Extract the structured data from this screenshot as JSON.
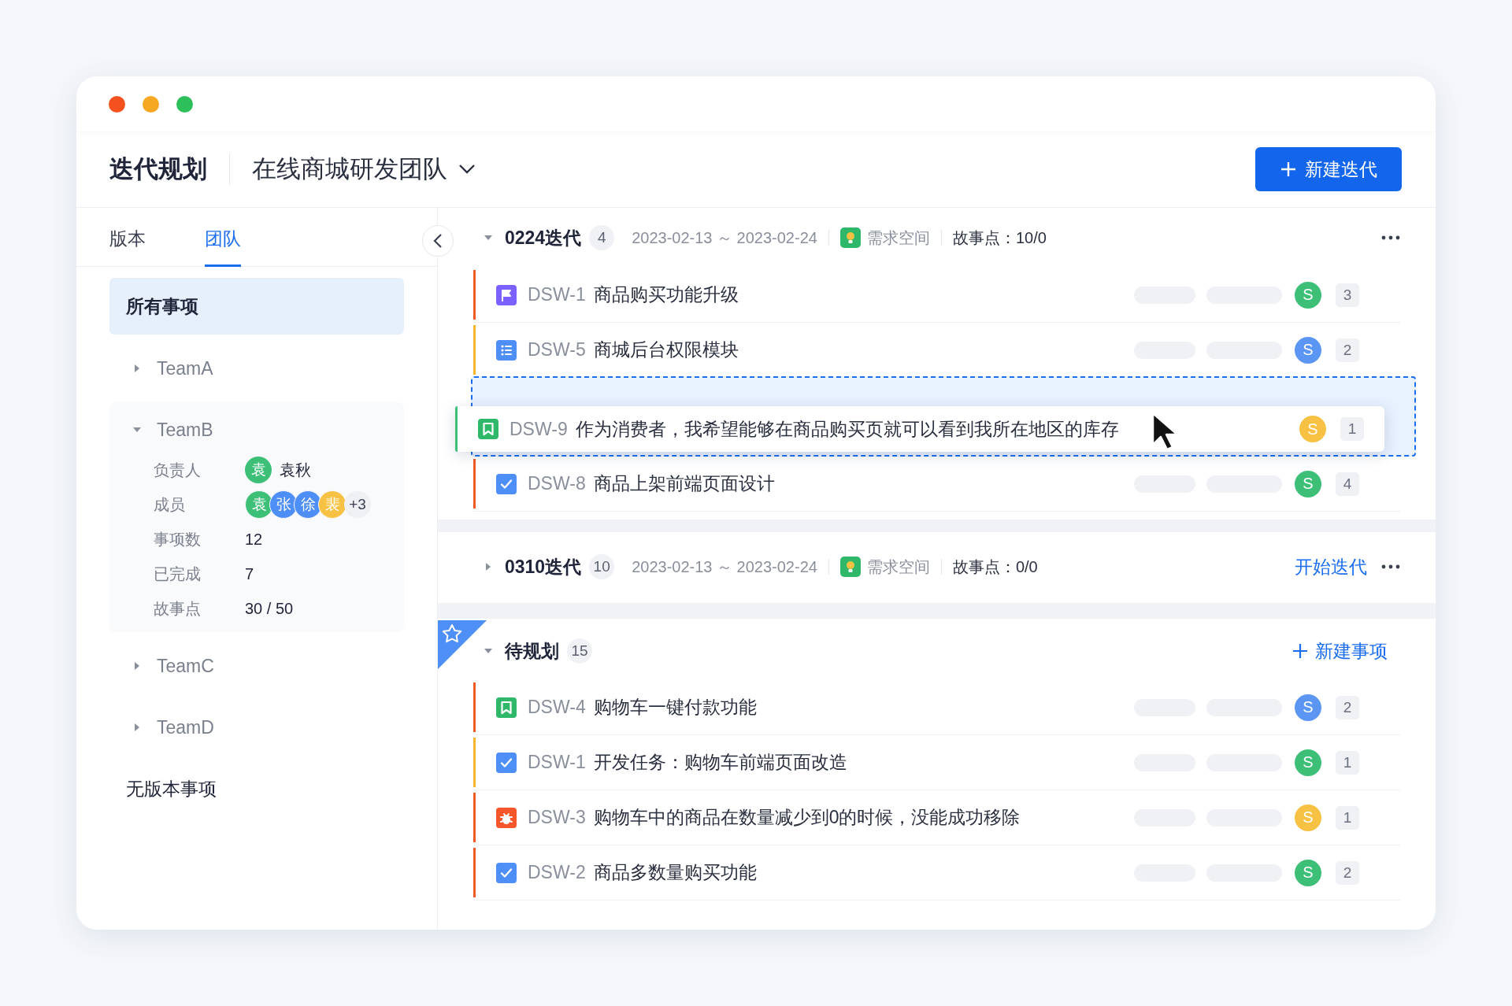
{
  "header": {
    "title": "迭代规划",
    "team": "在线商城研发团队",
    "new_button": "新建迭代"
  },
  "sidebar": {
    "tabs": [
      {
        "label": "版本",
        "selected": false
      },
      {
        "label": "团队",
        "selected": true
      }
    ],
    "items": [
      {
        "kind": "all",
        "label": "所有事项",
        "selected": true
      },
      {
        "kind": "team",
        "label": "TeamA",
        "expanded": false
      },
      {
        "kind": "team",
        "label": "TeamB",
        "expanded": true,
        "details": {
          "owner_label": "负责人",
          "owner_avatar": {
            "text": "袁",
            "color": "#3dbf78"
          },
          "owner_name": "袁秋",
          "members_label": "成员",
          "members": [
            {
              "text": "袁",
              "color": "#3dbf78"
            },
            {
              "text": "张",
              "color": "#4d8ef7"
            },
            {
              "text": "徐",
              "color": "#4d8ef7"
            },
            {
              "text": "裴",
              "color": "#f7c244"
            }
          ],
          "members_more": "+3",
          "stats": [
            {
              "label": "事项数",
              "value": "12"
            },
            {
              "label": "已完成",
              "value": "7"
            },
            {
              "label": "故事点",
              "value": "30 / 50"
            }
          ]
        }
      },
      {
        "kind": "team",
        "label": "TeamC",
        "expanded": false
      },
      {
        "kind": "team",
        "label": "TeamD",
        "expanded": false
      },
      {
        "kind": "plain",
        "label": "无版本事项",
        "selected": false
      }
    ]
  },
  "iterations": [
    {
      "name": "0224迭代",
      "count": "4",
      "expanded": true,
      "dates": "2023-02-13 ～ 2023-02-24",
      "space": "需求空间",
      "points": "故事点：10/0",
      "rows": [
        {
          "kind": "feature",
          "color": "#f15a24",
          "id": "DSW-1",
          "title": "商品购买功能升级",
          "avatar": {
            "text": "S",
            "color": "#3dbf78"
          },
          "points": "3"
        },
        {
          "kind": "list",
          "color": "#f7b529",
          "id": "DSW-5",
          "title": "商城后台权限模块",
          "avatar": {
            "text": "S",
            "color": "#5b96f5"
          },
          "points": "2"
        },
        {
          "kind": "drop-slot",
          "dragging": {
            "kind": "story",
            "color": "#3dbf78",
            "id": "DSW-9",
            "title": "作为消费者，我希望能够在商品购买页就可以看到我所在地区的库存",
            "avatar": {
              "text": "S",
              "color": "#f7c244"
            },
            "points": "1"
          }
        },
        {
          "kind": "task",
          "color": "#f15a24",
          "id": "DSW-8",
          "title": "商品上架前端页面设计",
          "avatar": {
            "text": "S",
            "color": "#3dbf78"
          },
          "points": "4"
        }
      ]
    },
    {
      "name": "0310迭代",
      "count": "10",
      "expanded": false,
      "dates": "2023-02-13 ～ 2023-02-24",
      "space": "需求空间",
      "points": "故事点：0/0",
      "action": "开始迭代"
    }
  ],
  "backlog": {
    "title": "待规划",
    "count": "15",
    "expanded": true,
    "starred": true,
    "new_button": "新建事项",
    "rows": [
      {
        "kind": "story",
        "color": "#f15a24",
        "id": "DSW-4",
        "title": "购物车一键付款功能",
        "avatar": {
          "text": "S",
          "color": "#5b96f5"
        },
        "points": "2"
      },
      {
        "kind": "task",
        "color": "#f7b529",
        "id": "DSW-1",
        "title": "开发任务：购物车前端页面改造",
        "avatar": {
          "text": "S",
          "color": "#3dbf78"
        },
        "points": "1"
      },
      {
        "kind": "bug",
        "color": "#f15a24",
        "id": "DSW-3",
        "title": "购物车中的商品在数量减少到0的时候，没能成功移除",
        "avatar": {
          "text": "S",
          "color": "#f7c244"
        },
        "points": "1"
      },
      {
        "kind": "task",
        "color": "#f15a24",
        "id": "DSW-2",
        "title": "商品多数量购买功能",
        "avatar": {
          "text": "S",
          "color": "#3dbf78"
        },
        "points": "2"
      }
    ]
  }
}
